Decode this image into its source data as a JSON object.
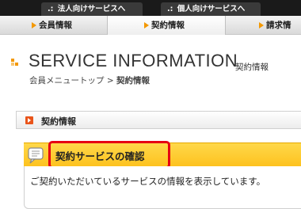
{
  "top_tabs": [
    {
      "prefix": ".:",
      "label": "法人向けサービスへ"
    },
    {
      "prefix": ".:",
      "label": "個人向けサービスへ"
    }
  ],
  "nav": {
    "items": [
      {
        "label": "会員情報"
      },
      {
        "label": "契約情報"
      },
      {
        "label": "請求情"
      }
    ]
  },
  "page": {
    "title": "SERVICE INFORMATION",
    "subtitle": "契約情報",
    "breadcrumb_home": "会員メニュートップ",
    "breadcrumb_sep": ">",
    "breadcrumb_current": "契約情報"
  },
  "section": {
    "label": "契約情報"
  },
  "headline": {
    "text": "契約サービスの確認"
  },
  "description": {
    "text": "ご契約いただいているサービスの情報を表示しています。"
  },
  "colors": {
    "accent_orange": "#f39800",
    "highlight_yellow": "#fdc21f",
    "annotation_red": "#e60012",
    "section_icon": "#e9541a"
  }
}
